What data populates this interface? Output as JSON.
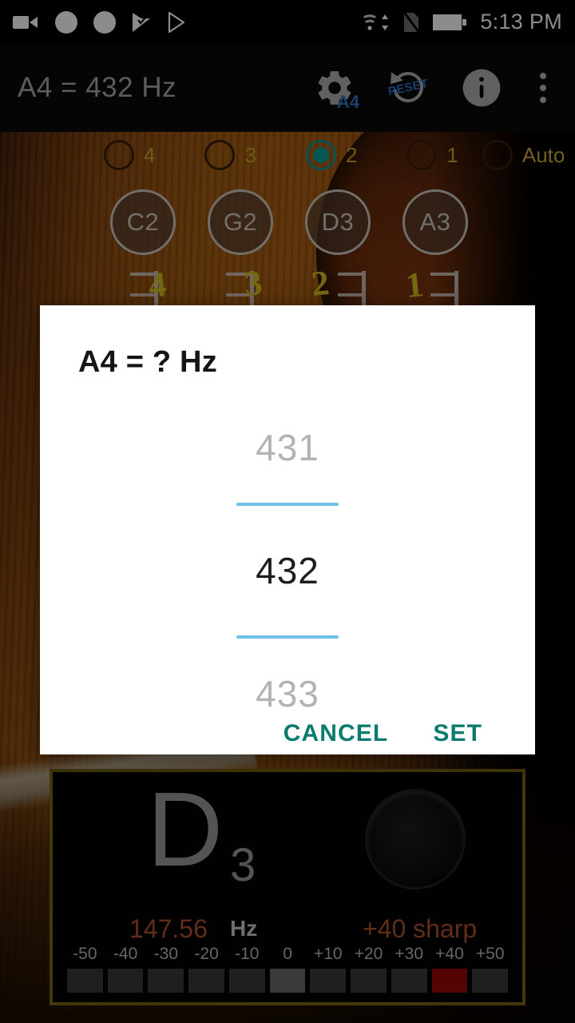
{
  "status_bar": {
    "time": "5:13 PM",
    "left_icons": [
      "camcorder-icon",
      "circle-icon",
      "circle-icon",
      "check-flag-icon",
      "play-store-icon"
    ],
    "right_icons": [
      "wifi-icon",
      "no-sim-icon",
      "battery-icon"
    ]
  },
  "app_bar": {
    "title": "A4 = 432 Hz",
    "gear_badge": "A4",
    "reset_label": "RESET",
    "actions": [
      "settings-a4-button",
      "reset-button",
      "info-button",
      "overflow-menu-button"
    ]
  },
  "string_selector": {
    "options": [
      {
        "label": "4",
        "selected": false
      },
      {
        "label": "3",
        "selected": false
      },
      {
        "label": "2",
        "selected": true
      },
      {
        "label": "1",
        "selected": false
      },
      {
        "label": "Auto",
        "selected": false
      }
    ]
  },
  "note_buttons": [
    "C2",
    "G2",
    "D3",
    "A3"
  ],
  "background_string_numbers": [
    "4",
    "3",
    "2",
    "1"
  ],
  "dialog": {
    "title": "A4 = ? Hz",
    "picker": {
      "previous": "431",
      "current": "432",
      "next": "433"
    },
    "cancel_label": "CANCEL",
    "set_label": "SET",
    "accent_color": "#0b7b6e",
    "divider_color": "#6fc1e8"
  },
  "tuner": {
    "note": "D",
    "octave": "3",
    "frequency": "147.56",
    "unit": "Hz",
    "cents_text": "+40 sharp",
    "freq_color": "#b2522c",
    "border_color": "#7a6713",
    "active_color": "#9c0606",
    "scale": {
      "labels": [
        "-50",
        "-40",
        "-30",
        "-20",
        "-10",
        "0",
        "+10",
        "+20",
        "+30",
        "+40",
        "+50"
      ],
      "active_index": 9,
      "center_index": 5
    }
  }
}
